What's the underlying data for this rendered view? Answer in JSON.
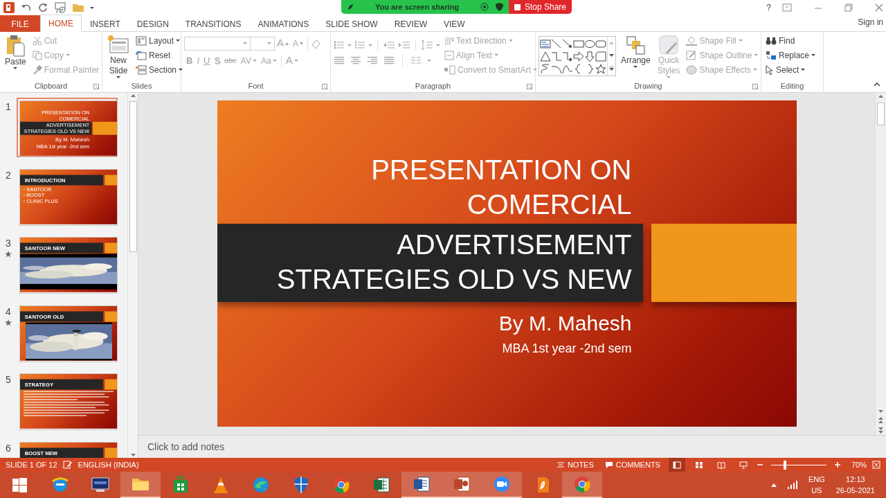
{
  "title_bar": {
    "help": "?",
    "share_status": "You are screen sharing",
    "stop_button": "Stop Share"
  },
  "tabs": [
    {
      "label": "FILE",
      "kind": "file",
      "selected": false
    },
    {
      "label": "HOME",
      "kind": "tab",
      "selected": true
    },
    {
      "label": "INSERT",
      "kind": "tab",
      "selected": false
    },
    {
      "label": "DESIGN",
      "kind": "tab",
      "selected": false
    },
    {
      "label": "TRANSITIONS",
      "kind": "tab",
      "selected": false
    },
    {
      "label": "ANIMATIONS",
      "kind": "tab",
      "selected": false
    },
    {
      "label": "SLIDE SHOW",
      "kind": "tab",
      "selected": false
    },
    {
      "label": "REVIEW",
      "kind": "tab",
      "selected": false
    },
    {
      "label": "VIEW",
      "kind": "tab",
      "selected": false
    }
  ],
  "sign_in": "Sign in",
  "ribbon": {
    "clipboard": {
      "label": "Clipboard",
      "paste": {
        "label": "Paste",
        "disabled": false
      },
      "small": [
        {
          "label": "Cut",
          "disabled": true
        },
        {
          "label": "Copy",
          "disabled": true
        },
        {
          "label": "Format Painter",
          "disabled": true
        }
      ]
    },
    "slides": {
      "label": "Slides",
      "new_slide": {
        "label": "New Slide",
        "disabled": false
      },
      "small": [
        {
          "label": "Layout",
          "disabled": false
        },
        {
          "label": "Reset",
          "disabled": false
        },
        {
          "label": "Section",
          "disabled": false
        }
      ]
    },
    "font": {
      "label": "Font",
      "disabled": true,
      "size_buttons": [
        "A",
        "A"
      ],
      "format_buttons": [
        "B",
        "I",
        "U",
        "S",
        "abc",
        "AV",
        "Aa"
      ],
      "color_button": "A"
    },
    "paragraph": {
      "label": "Paragraph",
      "tools_disabled": true,
      "small": [
        {
          "label": "Text Direction",
          "disabled": true
        },
        {
          "label": "Align Text",
          "disabled": true
        },
        {
          "label": "Convert to SmartArt",
          "disabled": true
        }
      ]
    },
    "drawing": {
      "label": "Drawing",
      "arrange": {
        "label": "Arrange",
        "disabled": false
      },
      "quick_styles": {
        "label": "Quick Styles",
        "disabled": true
      },
      "small": [
        {
          "label": "Shape Fill",
          "disabled": true
        },
        {
          "label": "Shape Outline",
          "disabled": true
        },
        {
          "label": "Shape Effects",
          "disabled": true
        }
      ]
    },
    "editing": {
      "label": "Editing",
      "small": [
        {
          "label": "Find",
          "disabled": false
        },
        {
          "label": "Replace",
          "disabled": false
        },
        {
          "label": "Select",
          "disabled": false
        }
      ]
    }
  },
  "slides": [
    {
      "number": "1",
      "selected": true,
      "animated": false,
      "kind": "title",
      "title_lines": [
        {
          "text": "PRESENTATION ON",
          "on_band": false
        },
        {
          "text": "COMERCIAL",
          "on_band": false
        },
        {
          "text": "ADVERTISEMENT",
          "on_band": true
        },
        {
          "text": "STRATEGIES OLD VS NEW",
          "on_band": true
        }
      ],
      "author": "By M. Mahesh",
      "course": "MBA 1st year -2nd sem"
    },
    {
      "number": "2",
      "selected": false,
      "animated": false,
      "kind": "content",
      "title": "INTRODUCTION",
      "bullets": [
        "SANTOOR",
        "BOOST",
        "CLINIC PLUS"
      ]
    },
    {
      "number": "3",
      "selected": false,
      "animated": true,
      "kind": "video",
      "title": "SANTOOR NEW"
    },
    {
      "number": "4",
      "selected": false,
      "animated": true,
      "kind": "video_inset",
      "title": "SANTOOR OLD"
    },
    {
      "number": "5",
      "selected": false,
      "animated": false,
      "kind": "content_dense",
      "title": "STRATEGY"
    },
    {
      "number": "6",
      "selected": false,
      "animated": false,
      "kind": "content",
      "title": "BOOST NEW"
    }
  ],
  "current_slide": {
    "title_lines": [
      {
        "text": "PRESENTATION ON",
        "on_band": false
      },
      {
        "text": "COMERCIAL",
        "on_band": false
      },
      {
        "text": "ADVERTISEMENT",
        "on_band": true
      },
      {
        "text": "STRATEGIES OLD VS NEW",
        "on_band": true
      }
    ],
    "author": "By M. Mahesh",
    "course": "MBA 1st year -2nd sem"
  },
  "notes_placeholder": "Click to add notes",
  "status_bar": {
    "slide_count": "SLIDE 1 OF 12",
    "language": "ENGLISH (INDIA)",
    "notes": "NOTES",
    "comments": "COMMENTS",
    "views": [
      {
        "selected": true
      },
      {
        "selected": false
      },
      {
        "selected": false
      },
      {
        "selected": false
      }
    ],
    "zoom": {
      "level": 0.25
    },
    "zoom_reading": "70%"
  },
  "taskbar": {
    "apps": [
      {
        "highlighted": false
      },
      {
        "highlighted": false
      },
      {
        "highlighted": true
      },
      {
        "highlighted": false
      },
      {
        "highlighted": false
      },
      {
        "highlighted": false
      },
      {
        "highlighted": false
      },
      {
        "highlighted": false
      },
      {
        "highlighted": false
      },
      {
        "highlighted": true
      },
      {
        "highlighted": true
      },
      {
        "highlighted": true
      },
      {
        "highlighted": false
      },
      {
        "highlighted": true
      }
    ],
    "language": "ENG",
    "region": "US",
    "time": "12:13",
    "date": "26-05-2021"
  }
}
